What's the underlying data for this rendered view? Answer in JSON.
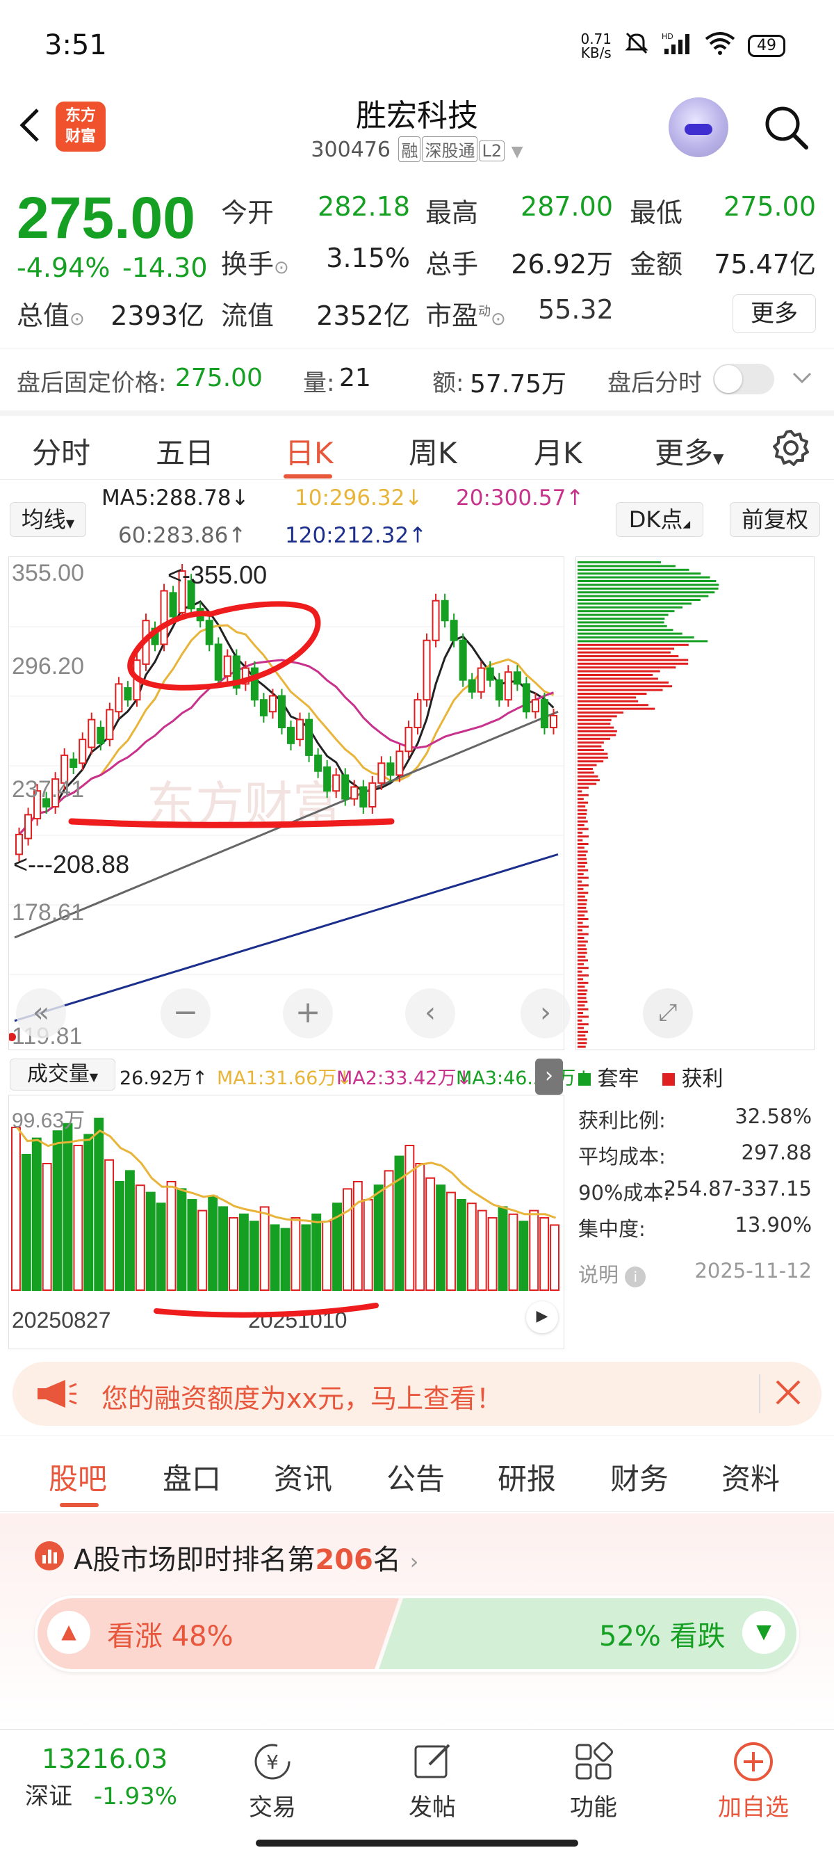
{
  "status": {
    "time": "3:51",
    "net_speed_top": "0.71",
    "net_speed_unit": "KB/s",
    "battery": "49"
  },
  "header": {
    "logo_line1": "东方",
    "logo_line2": "财富",
    "stock_name": "胜宏科技",
    "stock_code": "300476",
    "tag_rong": "融",
    "tag_sgt": "深股通",
    "tag_l2": "L2"
  },
  "quote": {
    "price": "275.00",
    "change_pct": "-4.94%",
    "change_abs": "-14.30",
    "open_label": "今开",
    "open": "282.18",
    "high_label": "最高",
    "high": "287.00",
    "low_label": "最低",
    "low": "275.00",
    "turnover_label": "换手",
    "turnover": "3.15%",
    "volume_label": "总手",
    "volume": "26.92万",
    "amount_label": "金额",
    "amount": "75.47亿",
    "mktcap_label": "总值",
    "mktcap": "2393亿",
    "float_label": "流值",
    "float": "2352亿",
    "pe_label": "市盈",
    "pe_sup": "动",
    "pe": "55.32",
    "more_label": "更多"
  },
  "after_hours": {
    "price_label": "盘后固定价格:",
    "price": "275.00",
    "vol_label": "量:",
    "vol": "21",
    "amt_label": "额:",
    "amt": "57.75万",
    "timeshare_label": "盘后分时"
  },
  "chart_tabs": [
    "分时",
    "五日",
    "日K",
    "周K",
    "月K",
    "更多"
  ],
  "ma_legend": {
    "selector": "均线",
    "ma5": "MA5:288.78↓",
    "ma10": "10:296.32↓",
    "ma20": "20:300.57↑",
    "ma60": "60:283.86↑",
    "ma120": "120:212.32↑",
    "dk_label": "DK点",
    "adjust_label": "前复权"
  },
  "kline": {
    "y_labels": [
      "355.00",
      "296.20",
      "237.41",
      "178.61",
      "119.81"
    ],
    "max_marker": "<-355.00",
    "min_marker": "<---208.88",
    "watermark": "东方财富"
  },
  "volume_legend": {
    "selector": "成交量",
    "vol": "26.92万↑",
    "ma1": "MA1:31.66万↓",
    "ma2": "MA2:33.42万↓",
    "ma3": "MA3:46.57万↓"
  },
  "volume_chart": {
    "max_label": "99.63万",
    "date_start": "20250827",
    "date_mid": "20251010"
  },
  "distribution": {
    "legend_trapped": "套牢",
    "legend_profit": "获利",
    "rows": [
      {
        "k": "获利比例:",
        "v": "32.58%"
      },
      {
        "k": "平均成本:",
        "v": "297.88"
      },
      {
        "k": "90%成本:",
        "v": "254.87-337.15"
      },
      {
        "k": "集中度:",
        "v": "13.90%"
      }
    ],
    "note_label": "说明",
    "date": "2025-11-12"
  },
  "banner": {
    "text": "您的融资额度为xx元，马上查看！"
  },
  "info_tabs": [
    "股吧",
    "盘口",
    "资讯",
    "公告",
    "研报",
    "财务",
    "资料"
  ],
  "ranking": {
    "prefix": "A股市场即时排名第",
    "rank": "206",
    "suffix": "名",
    "bull_label": "看涨",
    "bull_pct": "48%",
    "bear_label": "看跌",
    "bear_pct": "52%"
  },
  "bottom_nav": {
    "index_value": "13216.03",
    "index_name": "深证",
    "index_pct": "-1.93%",
    "trade": "交易",
    "post": "发帖",
    "func": "功能",
    "add": "加自选"
  },
  "colors": {
    "accent": "#e8563b",
    "up": "#e02020",
    "down": "#16a023",
    "ma5": "#222222",
    "ma10": "#e8b43a",
    "ma20": "#c8318c",
    "ma60": "#666666",
    "ma120": "#1c2f8c"
  }
}
